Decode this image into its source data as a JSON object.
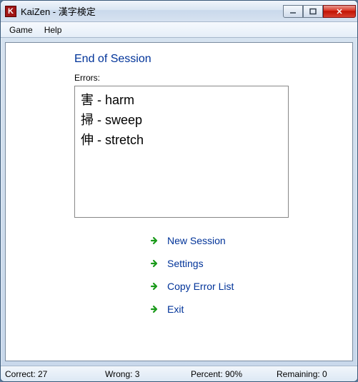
{
  "window": {
    "title": "KaiZen - 漢字検定",
    "app_icon_letter": "K"
  },
  "menu": {
    "game": "Game",
    "help": "Help"
  },
  "main": {
    "heading": "End of Session",
    "errors_label": "Errors:",
    "errors": [
      "害 - harm",
      "掃 - sweep",
      "伸 - stretch"
    ]
  },
  "actions": {
    "new_session": "New Session",
    "settings": "Settings",
    "copy_errors": "Copy Error List",
    "exit": "Exit"
  },
  "status": {
    "correct": "Correct: 27",
    "wrong": "Wrong: 3",
    "percent": "Percent: 90%",
    "remaining": "Remaining: 0"
  },
  "colors": {
    "link": "#003399",
    "arrow": "#1a9a1a"
  }
}
